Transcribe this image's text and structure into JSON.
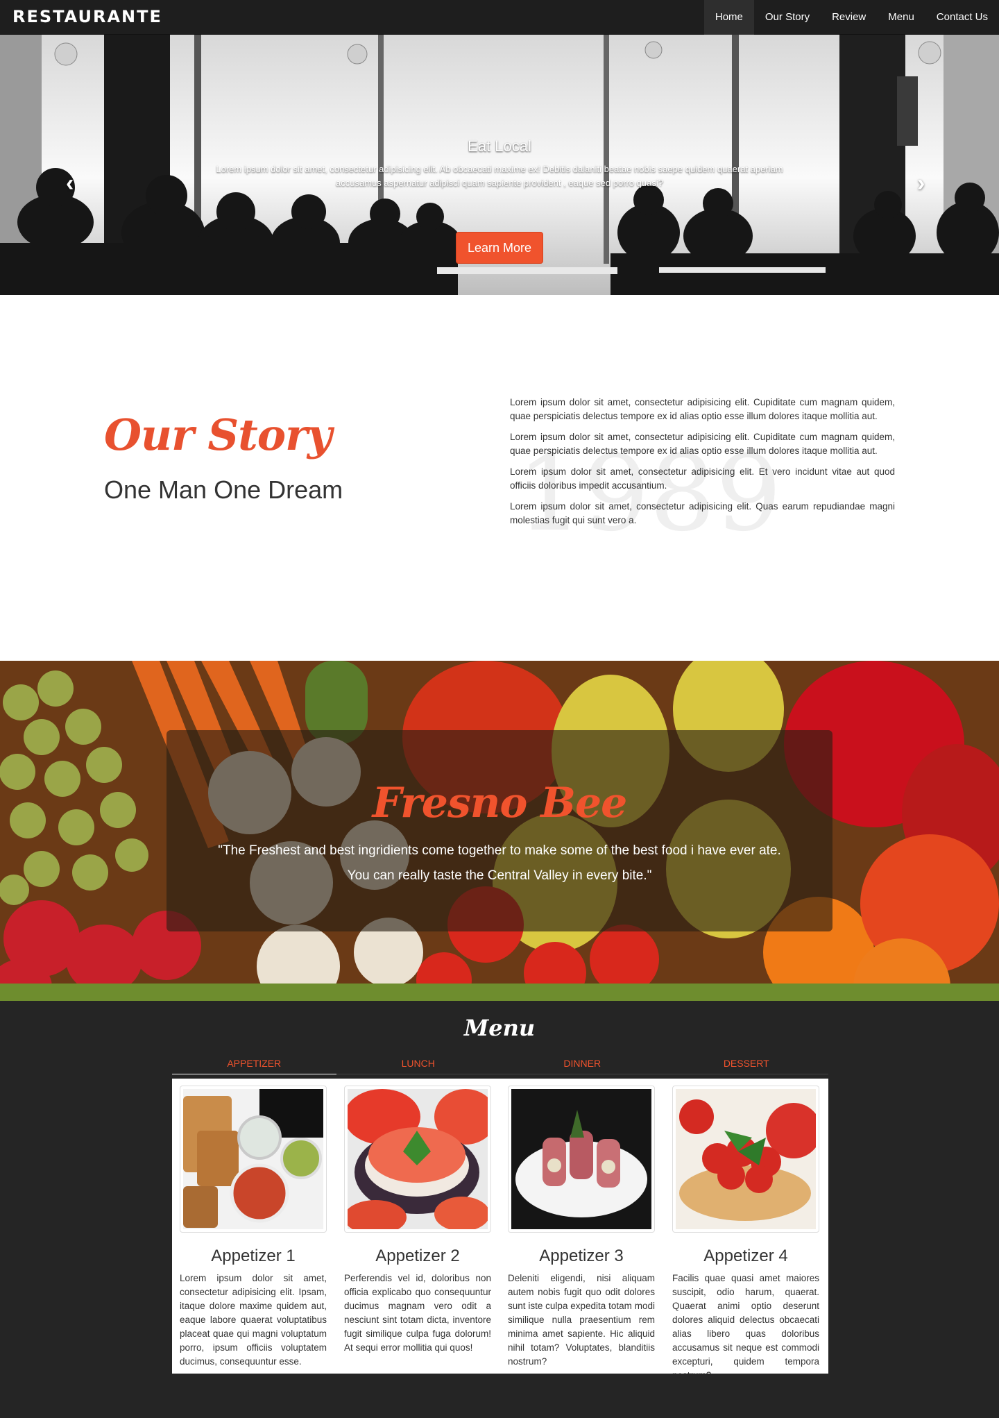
{
  "nav": {
    "brand": "RESTAURANTE",
    "links": [
      "Home",
      "Our Story",
      "Review",
      "Menu",
      "Contact Us"
    ]
  },
  "hero": {
    "title": "Eat Local",
    "text": "Lorem ipsum dolor sit amet, consectetur adipisicing elit. Ab obcaecati maxime ex! Debitis dalaniti beatae nobis saepe quidem quaerat aperiam accusamus aspernatur adipisci quam sapiente provident , eaque sed porro quasi?",
    "button": "Learn More",
    "prev_icon": "‹",
    "next_icon": "›"
  },
  "story": {
    "script_title": "Our Story",
    "subtitle": "One Man One Dream",
    "watermark": "1989",
    "paragraphs": [
      "Lorem ipsum dolor sit amet, consectetur adipisicing elit. Cupiditate cum magnam quidem, quae perspiciatis delectus tempore ex id alias optio esse illum dolores itaque mollitia aut.",
      "Lorem ipsum dolor sit amet, consectetur adipisicing elit. Cupiditate cum magnam quidem, quae perspiciatis delectus tempore ex id alias optio esse illum dolores itaque mollitia aut.",
      "Lorem ipsum dolor sit amet, consectetur adipisicing elit. Et vero incidunt vitae aut quod officiis doloribus impedit accusantium.",
      "Lorem ipsum dolor sit amet, consectetur adipisicing elit. Quas earum repudiandae magni molestias fugit qui sunt vero a."
    ]
  },
  "review": {
    "title": "Fresno Bee",
    "quote": "\"The Freshest and best ingridients come together to make some of the best food i have ever ate. You can really taste the Central Valley in every bite.\""
  },
  "menu": {
    "title": "Menu",
    "tabs": [
      "APPETIZER",
      "LUNCH",
      "DINNER",
      "DESSERT"
    ],
    "items": [
      {
        "title": "Appetizer 1",
        "desc": "Lorem ipsum dolor sit amet, consectetur adipisicing elit. Ipsam, itaque dolore maxime quidem aut, eaque labore quaerat voluptatibus placeat quae qui magni voluptatum porro, ipsum officiis voluptatem ducimus, consequuntur esse."
      },
      {
        "title": "Appetizer 2",
        "desc": "Perferendis vel id, doloribus non officia explicabo quo consequuntur ducimus magnam vero odit a nesciunt sint totam dicta, inventore fugit similique culpa fuga dolorum! At sequi error mollitia qui quos!"
      },
      {
        "title": "Appetizer 3",
        "desc": "Deleniti eligendi, nisi aliquam autem nobis fugit quo odit dolores sunt iste culpa expedita totam modi similique nulla praesentium rem minima amet sapiente. Hic aliquid nihil totam? Voluptates, blanditiis nostrum?"
      },
      {
        "title": "Appetizer 4",
        "desc": "Facilis quae quasi amet maiores suscipit, odio harum, quaerat. Quaerat animi optio deserunt dolores aliquid delectus obcaecati alias libero quas doloribus accusamus sit neque est commodi excepturi, quidem tempora nostrum?"
      }
    ]
  }
}
